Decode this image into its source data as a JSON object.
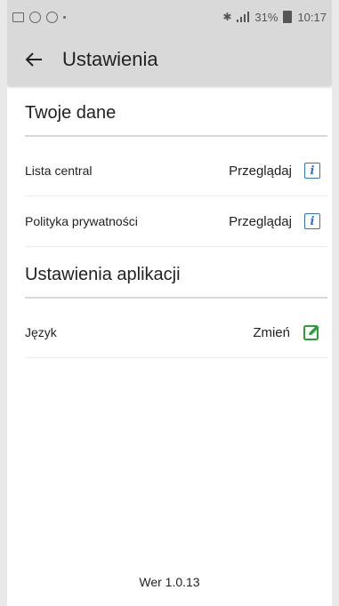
{
  "status_bar": {
    "battery": "31%",
    "time": "10:17"
  },
  "app_bar": {
    "title": "Ustawienia"
  },
  "sections": [
    {
      "title": "Twoje dane",
      "rows": [
        {
          "label": "Lista central",
          "action": "Przeglądaj",
          "icon": "info-icon"
        },
        {
          "label": "Polityka prywatności",
          "action": "Przeglądaj",
          "icon": "info-icon"
        }
      ]
    },
    {
      "title": "Ustawienia aplikacji",
      "rows": [
        {
          "label": "Język",
          "action": "Zmień",
          "icon": "edit-icon"
        }
      ]
    }
  ],
  "footer": {
    "version": "Wer 1.0.13"
  },
  "colors": {
    "accent_blue": "#2f73c9",
    "accent_green": "#2e9e3b",
    "bar_bg": "#d9d9d9"
  }
}
